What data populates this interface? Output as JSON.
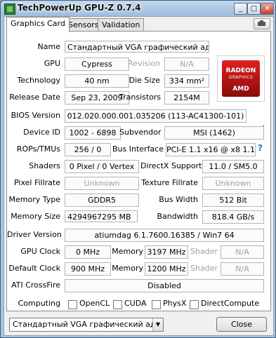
{
  "window": {
    "title": "TechPowerUp GPU-Z 0.7.4",
    "minimize": "_",
    "maximize": "□",
    "close": "✕"
  },
  "tabs": [
    "Graphics Card",
    "Sensors",
    "Validation"
  ],
  "fields": {
    "name": {
      "label": "Name",
      "value": "Стандартный VGA графический адап..."
    },
    "gpu": {
      "label": "GPU",
      "value": "Cypress"
    },
    "revision": {
      "label": "Revision",
      "value": "N/A"
    },
    "technology": {
      "label": "Technology",
      "value": "40 nm"
    },
    "die_size": {
      "label": "Die Size",
      "value": "334 mm²"
    },
    "release_date": {
      "label": "Release Date",
      "value": "Sep 23, 2009"
    },
    "transistors": {
      "label": "Transistors",
      "value": "2154M"
    },
    "bios_version": {
      "label": "BIOS Version",
      "value": "012.020.000.001.035206 (113-AC41300-101)"
    },
    "device_id": {
      "label": "Device ID",
      "value": "1002 - 6898"
    },
    "subvendor": {
      "label": "Subvendor",
      "value": "MSI (1462)"
    },
    "rops_tmus": {
      "label": "ROPs/TMUs",
      "value": "256 / 0"
    },
    "bus_interface": {
      "label": "Bus Interface",
      "value": "PCI-E 1.1 x16 @ x8 1.1"
    },
    "shaders": {
      "label": "Shaders",
      "value": "0 Pixel / 0 Vertex"
    },
    "directx": {
      "label": "DirectX Support",
      "value": "11.0 / SM5.0"
    },
    "pixel_fillrate": {
      "label": "Pixel Fillrate",
      "value": "Unknown"
    },
    "texture_fillrate": {
      "label": "Texture Fillrate",
      "value": "Unknown"
    },
    "memory_type": {
      "label": "Memory Type",
      "value": "GDDR5"
    },
    "bus_width": {
      "label": "Bus Width",
      "value": "512 Bit"
    },
    "memory_size": {
      "label": "Memory Size",
      "value": "4294967295 MB"
    },
    "bandwidth": {
      "label": "Bandwidth",
      "value": "818.4 GB/s"
    },
    "driver_version": {
      "label": "Driver Version",
      "value": "atiumdag 6.1.7600.16385 / Win7 64"
    },
    "gpu_clock": {
      "label": "GPU Clock",
      "value": "0 MHz"
    },
    "memory_clock": {
      "label": "Memory",
      "value": "3197 MHz"
    },
    "shader_clock": {
      "label": "Shader",
      "value": "N/A"
    },
    "default_clock": {
      "label": "Default Clock",
      "value": "900 MHz"
    },
    "default_memory": {
      "label": "Memory",
      "value": "1200 MHz"
    },
    "default_shader": {
      "label": "Shader",
      "value": "N/A"
    },
    "crossfire": {
      "label": "ATI CrossFire",
      "value": "Disabled"
    }
  },
  "logo": {
    "brand": "RADEON",
    "sub": "GRAPHICS",
    "maker": "AMD"
  },
  "computing": {
    "label": "Computing",
    "options": [
      {
        "label": "OpenCL",
        "checked": false
      },
      {
        "label": "CUDA",
        "checked": false
      },
      {
        "label": "PhysX",
        "checked": false
      },
      {
        "label": "DirectCompute",
        "checked": false
      }
    ]
  },
  "footer": {
    "selected_card": "Стандартный VGA графический адапте",
    "close_label": "Close"
  }
}
